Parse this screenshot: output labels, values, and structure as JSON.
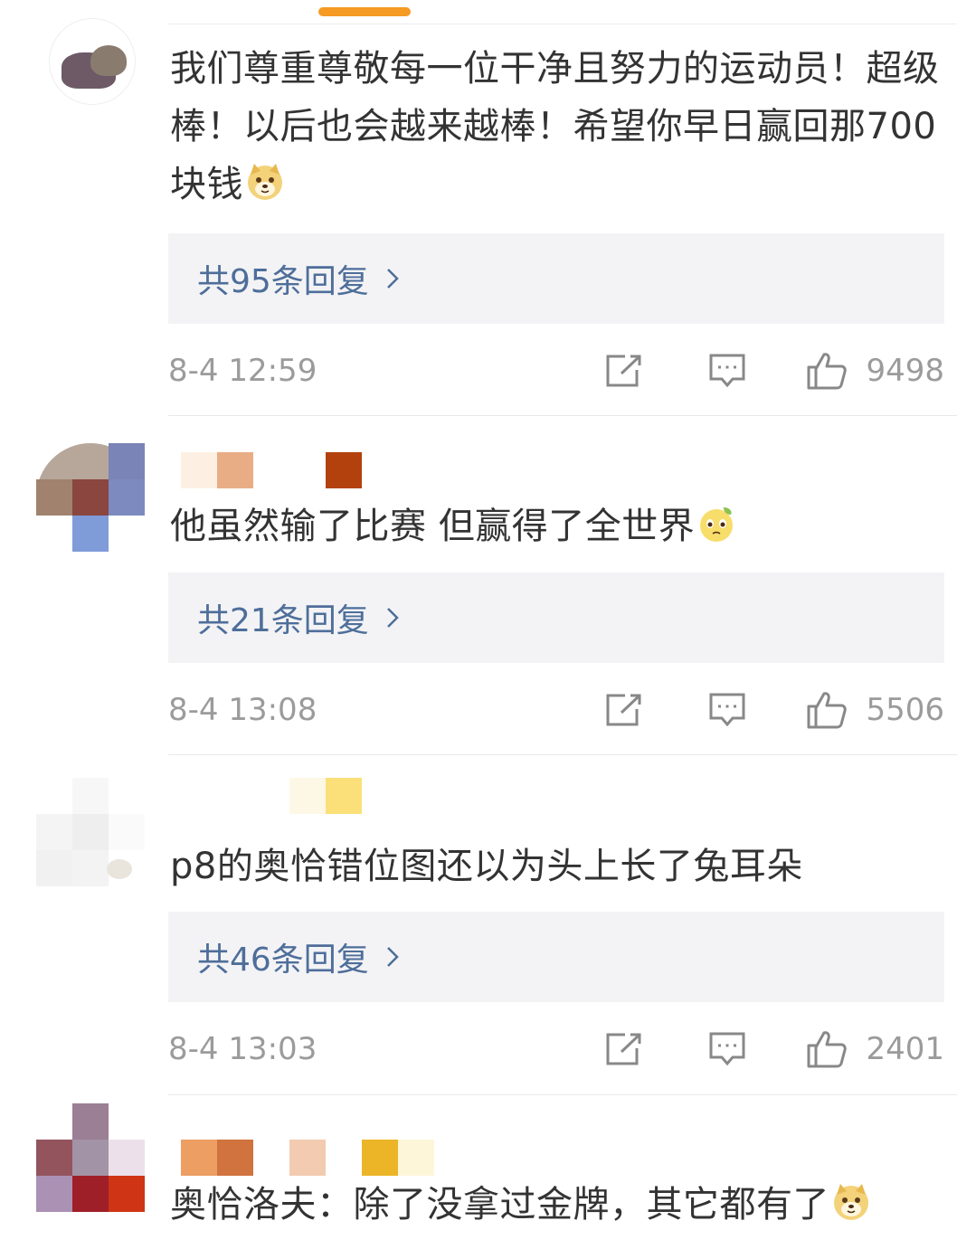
{
  "colors": {
    "accent": "#f59a23",
    "link": "#4e6e9a",
    "meta": "#9b9b9b",
    "reply_bg": "#f3f3f5"
  },
  "comments": [
    {
      "text": "我们尊重尊敬每一位干净且努力的运动员！超级棒！以后也会越来越棒！希望你早日赢回那700块钱",
      "emoji": "doge-emoji",
      "replies_label": "共95条回复",
      "time": "8-4 12:59",
      "likes": "9498"
    },
    {
      "text": "他虽然输了比赛 但赢得了全世界",
      "emoji": "pleading-face-emoji",
      "replies_label": "共21条回复",
      "time": "8-4 13:08",
      "likes": "5506"
    },
    {
      "text": "p8的奥恰错位图还以为头上长了兔耳朵",
      "emoji": "",
      "replies_label": "共46条回复",
      "time": "8-4 13:03",
      "likes": "2401"
    },
    {
      "text": "奥恰洛夫：除了没拿过金牌，其它都有了",
      "emoji": "doge-emoji"
    }
  ],
  "icons": {
    "share": "share-icon",
    "comment": "comment-icon",
    "like": "like-icon",
    "chevron": "chevron-right-icon"
  }
}
